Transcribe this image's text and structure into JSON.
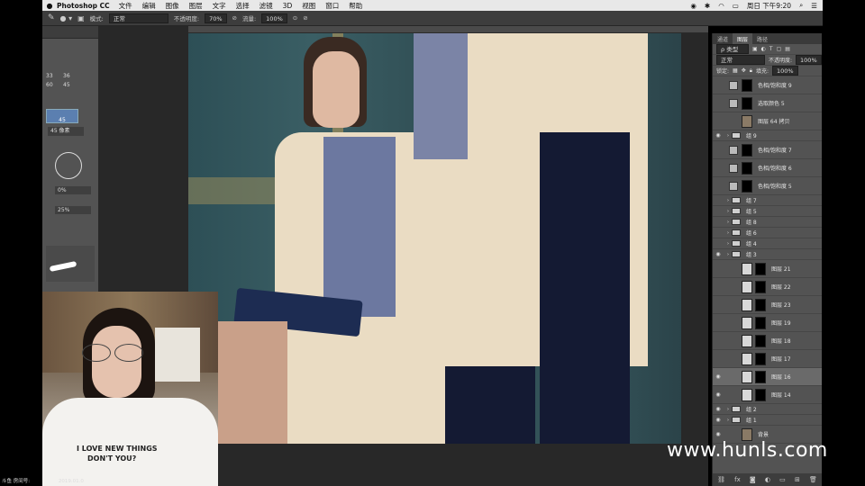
{
  "menubar": {
    "app_name": "Photoshop CC",
    "items": [
      "文件",
      "编辑",
      "图像",
      "图层",
      "文字",
      "选择",
      "滤镜",
      "3D",
      "视图",
      "窗口",
      "帮助"
    ],
    "clock": "周日 下午9:20"
  },
  "options_bar": {
    "mode_label": "模式:",
    "mode_value": "正常",
    "opacity_label": "不透明度:",
    "opacity_value": "70%",
    "flow_label": "流量:",
    "flow_value": "100%"
  },
  "brush_panel": {
    "sizes": [
      "33",
      "36",
      "60",
      "45",
      "45"
    ],
    "size_px": "45 像素",
    "hardness": "0%",
    "spacing": "25%"
  },
  "layers_panel": {
    "tabs": [
      "通道",
      "图层",
      "路径"
    ],
    "filter_label": "ρ 类型",
    "blend_mode": "正常",
    "opacity_label": "不透明度:",
    "opacity_value": "100%",
    "lock_label": "锁定:",
    "fill_label": "填充:",
    "fill_value": "100%",
    "layers": [
      {
        "name": "色相/饱和度 9",
        "kind": "adj",
        "visible": false
      },
      {
        "name": "选取颜色 5",
        "kind": "adj",
        "visible": false
      },
      {
        "name": "图层 64 拷贝",
        "kind": "photo",
        "visible": false
      },
      {
        "name": "组 9",
        "kind": "group",
        "visible": true
      },
      {
        "name": "色相/饱和度 7",
        "kind": "adj",
        "visible": false
      },
      {
        "name": "色相/饱和度 6",
        "kind": "adj",
        "visible": false
      },
      {
        "name": "色相/饱和度 5",
        "kind": "adj",
        "visible": false
      },
      {
        "name": "组 7",
        "kind": "group",
        "visible": false
      },
      {
        "name": "组 5",
        "kind": "group",
        "visible": false
      },
      {
        "name": "组 8",
        "kind": "group",
        "visible": false
      },
      {
        "name": "组 6",
        "kind": "group",
        "visible": false
      },
      {
        "name": "组 4",
        "kind": "group",
        "visible": false
      },
      {
        "name": "组 3",
        "kind": "group",
        "visible": true
      },
      {
        "name": "图层 21",
        "kind": "layer",
        "visible": false
      },
      {
        "name": "图层 22",
        "kind": "layer",
        "visible": false
      },
      {
        "name": "图层 23",
        "kind": "layer",
        "visible": false
      },
      {
        "name": "图层 19",
        "kind": "layer",
        "visible": false
      },
      {
        "name": "图层 18",
        "kind": "layer",
        "visible": false
      },
      {
        "name": "图层 17",
        "kind": "layer",
        "visible": false
      },
      {
        "name": "图层 16",
        "kind": "layer",
        "visible": true,
        "selected": true
      },
      {
        "name": "图层 14",
        "kind": "layer",
        "visible": true
      },
      {
        "name": "组 2",
        "kind": "group",
        "visible": true
      },
      {
        "name": "组 1",
        "kind": "group",
        "visible": true
      },
      {
        "name": "背景",
        "kind": "photo",
        "visible": true
      }
    ]
  },
  "webcam": {
    "shirt_line1": "I LOVE NEW THINGS",
    "shirt_line2": "DON'T YOU?",
    "room_label": "斗鱼 房间号:",
    "date": "2019.01.0"
  },
  "watermark": "www.hunls.com",
  "colors": {
    "panel": "#535353",
    "dark": "#282828",
    "canvas_bg": "#2f4c52",
    "coat": "#e9dcc4"
  }
}
